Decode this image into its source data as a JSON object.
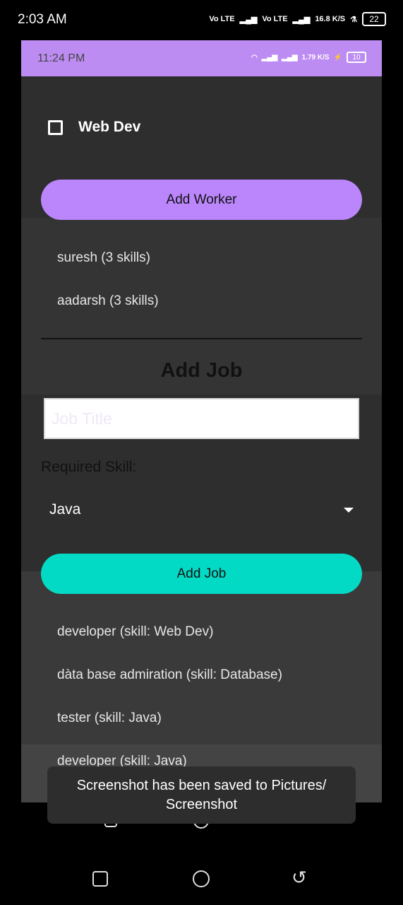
{
  "outer_status": {
    "time": "2:03 AM",
    "net1": "Vo LTE",
    "net2": "Vo LTE",
    "speed": "16.8 K/S",
    "battery": "22"
  },
  "inner_status": {
    "time": "11:24 PM",
    "speed": "1.79 K/S",
    "battery": "10"
  },
  "skills": {
    "checkbox_label": "Web Dev",
    "checked": false
  },
  "worker": {
    "add_button_label": "Add Worker",
    "list": [
      "suresh (3 skills)",
      "aadarsh (3 skills)"
    ]
  },
  "job_form": {
    "title": "Add Job",
    "title_placeholder": "Job Title",
    "required_skill_label": "Required Skill:",
    "selected_skill": "Java",
    "add_button_label": "Add Job"
  },
  "jobs": {
    "list": [
      "developer (skill: Web Dev)",
      "dàta base admiration (skill: Database)",
      "tester (skill: Java)",
      "developer (skill: Java)"
    ]
  },
  "toast": {
    "message": "Screenshot has been saved to  Pictures/ Screenshot"
  },
  "colors": {
    "accent_purple": "#bb86fc",
    "accent_teal": "#03dac5",
    "background": "#2c2c2c"
  }
}
